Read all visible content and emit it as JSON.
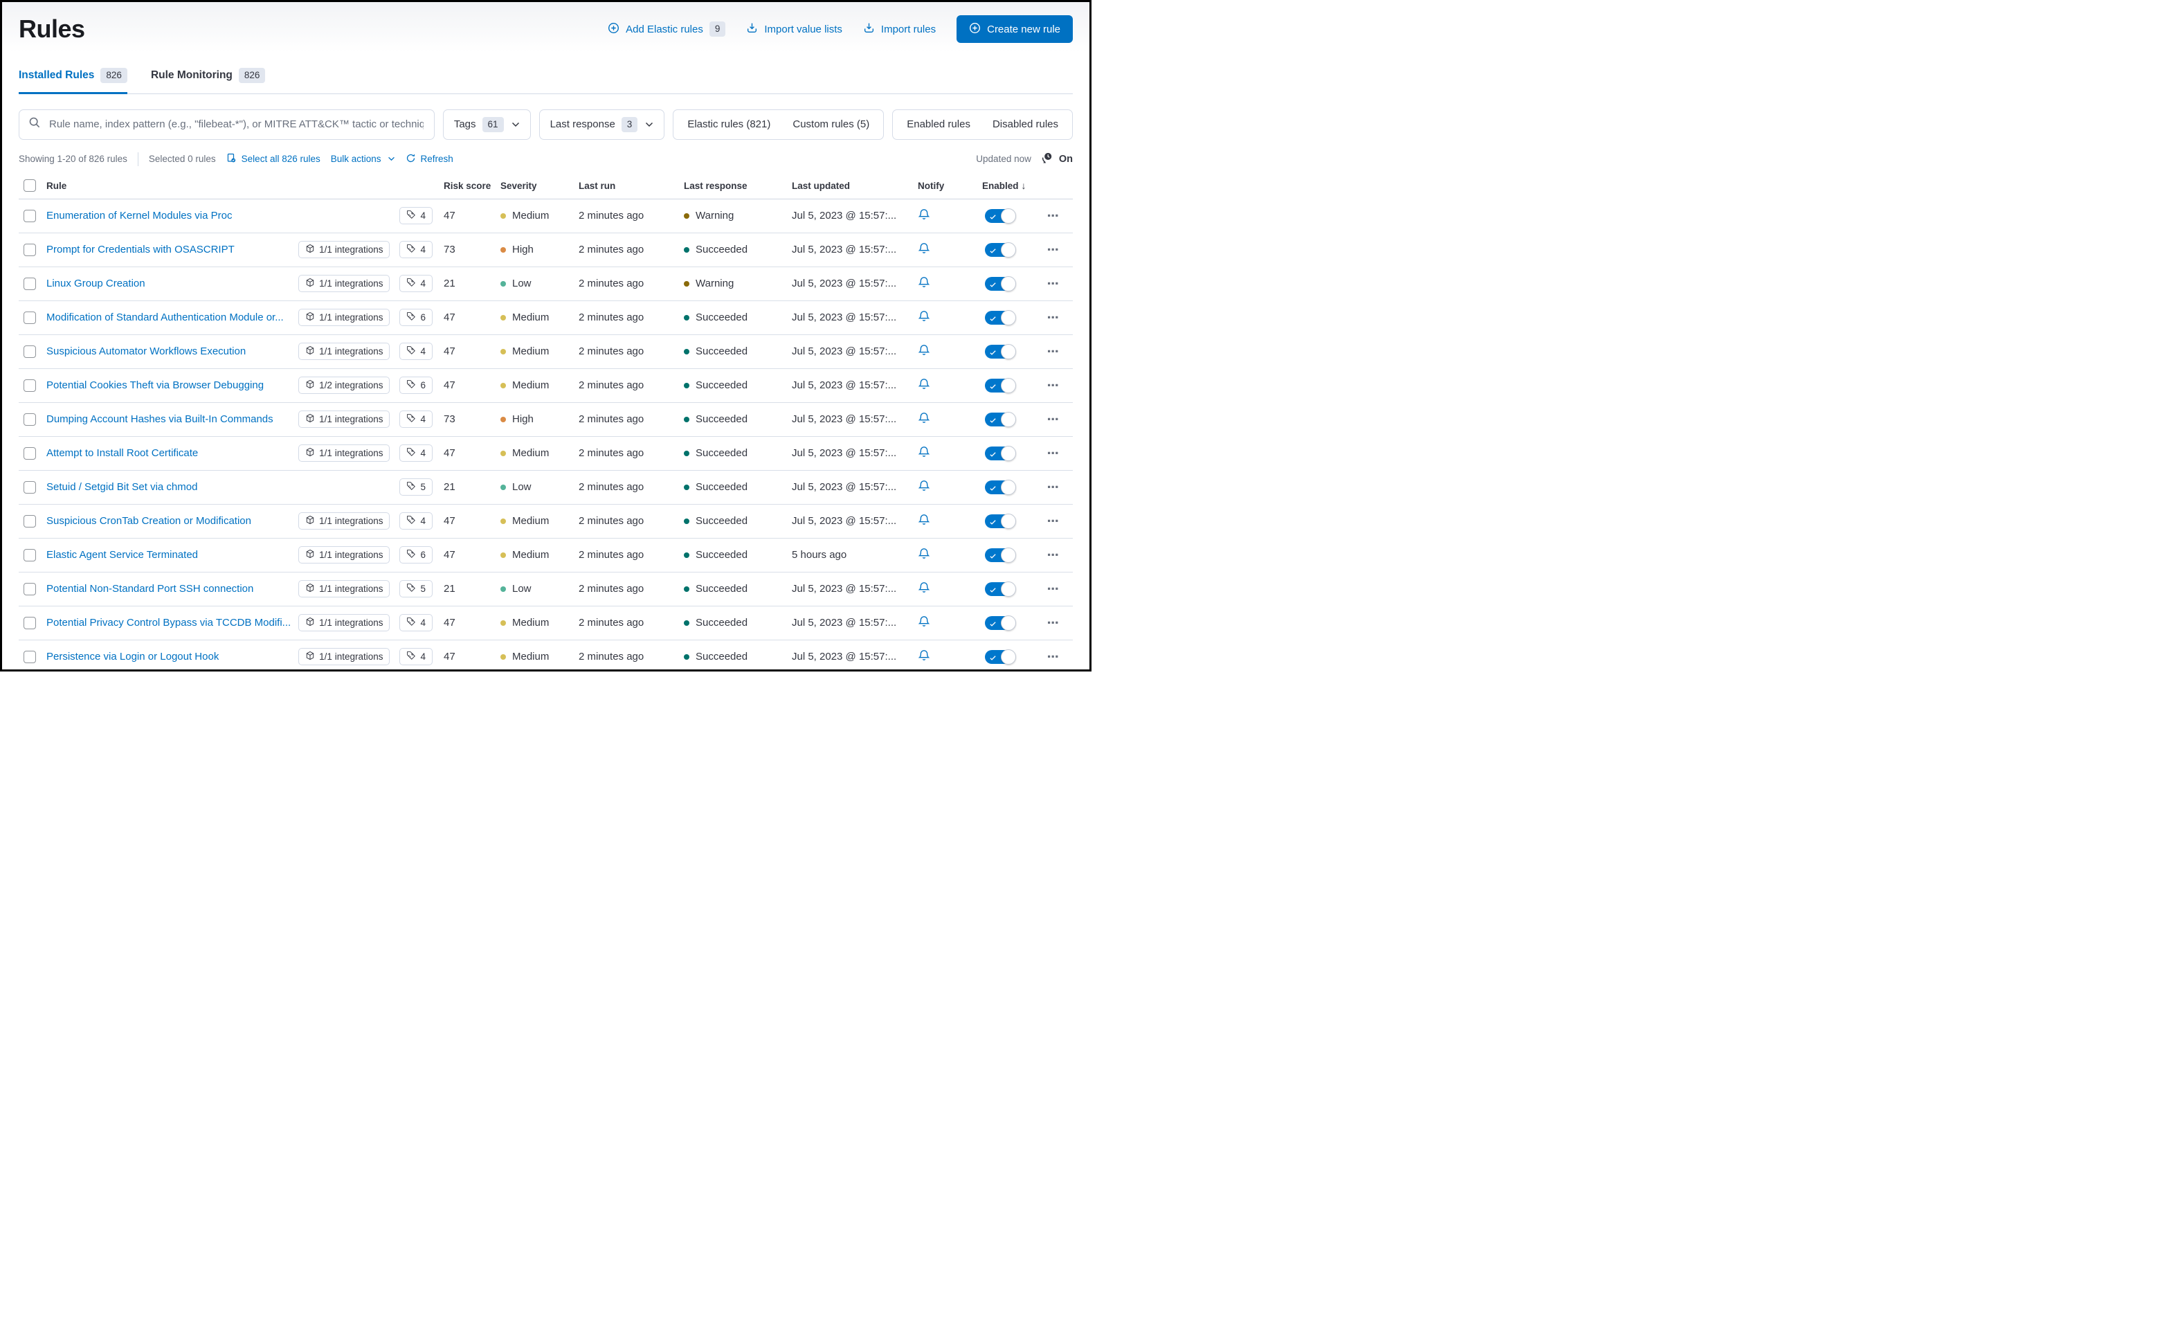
{
  "page": {
    "title": "Rules"
  },
  "header_actions": {
    "add_elastic_label": "Add Elastic rules",
    "add_elastic_count": "9",
    "import_value_lists_label": "Import value lists",
    "import_rules_label": "Import rules",
    "create_new_label": "Create new rule"
  },
  "tabs": [
    {
      "label": "Installed Rules",
      "count": "826"
    },
    {
      "label": "Rule Monitoring",
      "count": "826"
    }
  ],
  "search": {
    "placeholder": "Rule name, index pattern (e.g., \"filebeat-*\"), or MITRE ATT&CK™ tactic or technique (e.g., \"Defense Ev"
  },
  "filters": {
    "tags_label": "Tags",
    "tags_count": "61",
    "last_response_label": "Last response",
    "last_response_count": "3",
    "elastic_rules_label": "Elastic rules (821)",
    "custom_rules_label": "Custom rules (5)",
    "enabled_rules_label": "Enabled rules",
    "disabled_rules_label": "Disabled rules"
  },
  "utility": {
    "showing": "Showing 1-20 of 826 rules",
    "selected": "Selected 0 rules",
    "select_all": "Select all 826 rules",
    "bulk_actions": "Bulk actions",
    "refresh": "Refresh",
    "updated": "Updated now",
    "auto_refresh_state": "On"
  },
  "colors": {
    "primary": "#0071c2",
    "severity": {
      "Low": "#54B399",
      "Medium": "#D6BF57",
      "High": "#DA8B45"
    },
    "response": {
      "Succeeded": "#00726B",
      "Warning": "#8A6A0A"
    }
  },
  "table": {
    "columns": [
      "Rule",
      "Risk score",
      "Severity",
      "Last run",
      "Last response",
      "Last updated",
      "Notify",
      "Enabled"
    ],
    "sort_indicator": "↓",
    "rows": [
      {
        "name": "Enumeration of Kernel Modules via Proc",
        "integrations": null,
        "tags": "4",
        "risk": "47",
        "severity": "Medium",
        "last_run": "2 minutes ago",
        "last_response": "Warning",
        "last_updated": "Jul 5, 2023 @ 15:57:...",
        "enabled": true
      },
      {
        "name": "Prompt for Credentials with OSASCRIPT",
        "integrations": "1/1 integrations",
        "tags": "4",
        "risk": "73",
        "severity": "High",
        "last_run": "2 minutes ago",
        "last_response": "Succeeded",
        "last_updated": "Jul 5, 2023 @ 15:57:...",
        "enabled": true
      },
      {
        "name": "Linux Group Creation",
        "integrations": "1/1 integrations",
        "tags": "4",
        "risk": "21",
        "severity": "Low",
        "last_run": "2 minutes ago",
        "last_response": "Warning",
        "last_updated": "Jul 5, 2023 @ 15:57:...",
        "enabled": true
      },
      {
        "name": "Modification of Standard Authentication Module or...",
        "integrations": "1/1 integrations",
        "tags": "6",
        "risk": "47",
        "severity": "Medium",
        "last_run": "2 minutes ago",
        "last_response": "Succeeded",
        "last_updated": "Jul 5, 2023 @ 15:57:...",
        "enabled": true
      },
      {
        "name": "Suspicious Automator Workflows Execution",
        "integrations": "1/1 integrations",
        "tags": "4",
        "risk": "47",
        "severity": "Medium",
        "last_run": "2 minutes ago",
        "last_response": "Succeeded",
        "last_updated": "Jul 5, 2023 @ 15:57:...",
        "enabled": true
      },
      {
        "name": "Potential Cookies Theft via Browser Debugging",
        "integrations": "1/2 integrations",
        "tags": "6",
        "risk": "47",
        "severity": "Medium",
        "last_run": "2 minutes ago",
        "last_response": "Succeeded",
        "last_updated": "Jul 5, 2023 @ 15:57:...",
        "enabled": true
      },
      {
        "name": "Dumping Account Hashes via Built-In Commands",
        "integrations": "1/1 integrations",
        "tags": "4",
        "risk": "73",
        "severity": "High",
        "last_run": "2 minutes ago",
        "last_response": "Succeeded",
        "last_updated": "Jul 5, 2023 @ 15:57:...",
        "enabled": true
      },
      {
        "name": "Attempt to Install Root Certificate",
        "integrations": "1/1 integrations",
        "tags": "4",
        "risk": "47",
        "severity": "Medium",
        "last_run": "2 minutes ago",
        "last_response": "Succeeded",
        "last_updated": "Jul 5, 2023 @ 15:57:...",
        "enabled": true
      },
      {
        "name": "Setuid / Setgid Bit Set via chmod",
        "integrations": null,
        "tags": "5",
        "risk": "21",
        "severity": "Low",
        "last_run": "2 minutes ago",
        "last_response": "Succeeded",
        "last_updated": "Jul 5, 2023 @ 15:57:...",
        "enabled": true
      },
      {
        "name": "Suspicious CronTab Creation or Modification",
        "integrations": "1/1 integrations",
        "tags": "4",
        "risk": "47",
        "severity": "Medium",
        "last_run": "2 minutes ago",
        "last_response": "Succeeded",
        "last_updated": "Jul 5, 2023 @ 15:57:...",
        "enabled": true
      },
      {
        "name": "Elastic Agent Service Terminated",
        "integrations": "1/1 integrations",
        "tags": "6",
        "risk": "47",
        "severity": "Medium",
        "last_run": "2 minutes ago",
        "last_response": "Succeeded",
        "last_updated": "5 hours ago",
        "enabled": true
      },
      {
        "name": "Potential Non-Standard Port SSH connection",
        "integrations": "1/1 integrations",
        "tags": "5",
        "risk": "21",
        "severity": "Low",
        "last_run": "2 minutes ago",
        "last_response": "Succeeded",
        "last_updated": "Jul 5, 2023 @ 15:57:...",
        "enabled": true
      },
      {
        "name": "Potential Privacy Control Bypass via TCCDB Modifi...",
        "integrations": "1/1 integrations",
        "tags": "4",
        "risk": "47",
        "severity": "Medium",
        "last_run": "2 minutes ago",
        "last_response": "Succeeded",
        "last_updated": "Jul 5, 2023 @ 15:57:...",
        "enabled": true
      },
      {
        "name": "Persistence via Login or Logout Hook",
        "integrations": "1/1 integrations",
        "tags": "4",
        "risk": "47",
        "severity": "Medium",
        "last_run": "2 minutes ago",
        "last_response": "Succeeded",
        "last_updated": "Jul 5, 2023 @ 15:57:...",
        "enabled": true
      }
    ]
  }
}
